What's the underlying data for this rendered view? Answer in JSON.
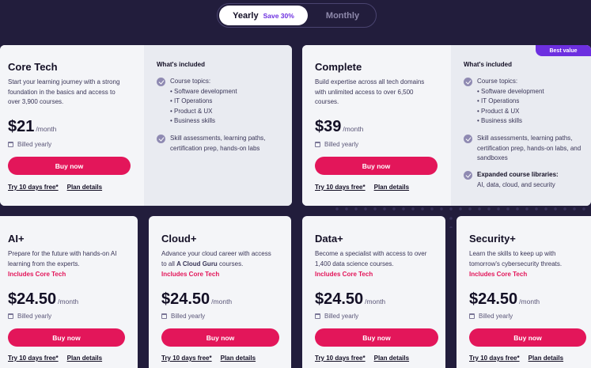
{
  "toggle": {
    "yearly": "Yearly",
    "save": "Save 30%",
    "monthly": "Monthly"
  },
  "common": {
    "per": "/month",
    "billed": "Billed yearly",
    "buy": "Buy now",
    "trial": "Try 10 days free*",
    "details": "Plan details",
    "whats_included": "What's included",
    "includes": "Includes Core Tech"
  },
  "core": {
    "title": "Core Tech",
    "desc_lines": [
      "Start your learning journey with a strong",
      "foundation in the basics and access to",
      "over 3,900 courses."
    ],
    "price": "$21",
    "topics_label": "Course topics:",
    "topics": [
      "Software development",
      "IT Operations",
      "Product & UX",
      "Business skills"
    ],
    "feature2_lines": [
      "Skill assessments, learning paths,",
      "certification prep, hands-on labs"
    ]
  },
  "complete": {
    "title": "Complete",
    "badge": "Best value",
    "desc_lines": [
      "Build expertise across all tech domains",
      "with unlimited access to over 6,500",
      "courses."
    ],
    "price": "$39",
    "topics_label": "Course topics:",
    "topics": [
      "Software development",
      "IT Operations",
      "Product & UX",
      "Business skills"
    ],
    "feature2_lines": [
      "Skill assessments, learning paths,",
      "certification prep, hands-on labs, and",
      "sandboxes"
    ],
    "feature3_title": "Expanded course libraries:",
    "feature3_text": "AI, data, cloud, and security"
  },
  "ai": {
    "title": "AI+",
    "desc_lines": [
      "Prepare for the future with hands-on AI",
      "learning from the experts."
    ],
    "price": "$24.50"
  },
  "cloud": {
    "title": "Cloud+",
    "desc_line1": "Advance your cloud career with access",
    "desc_pre": "to all ",
    "desc_brand": "A Cloud Guru",
    "desc_post": " courses.",
    "price": "$24.50"
  },
  "data": {
    "title": "Data+",
    "desc_lines": [
      "Become a specialist with access to over",
      "1,400 data science courses."
    ],
    "price": "$24.50"
  },
  "security": {
    "title": "Security+",
    "desc_lines": [
      "Learn the skills to keep up with",
      "tomorrow's cybersecurity threats."
    ],
    "price": "$24.50"
  },
  "colors": {
    "background": "#221d3c",
    "accent": "#e3165a",
    "purple": "#6d2fe0",
    "card": "#f4f5f8"
  }
}
